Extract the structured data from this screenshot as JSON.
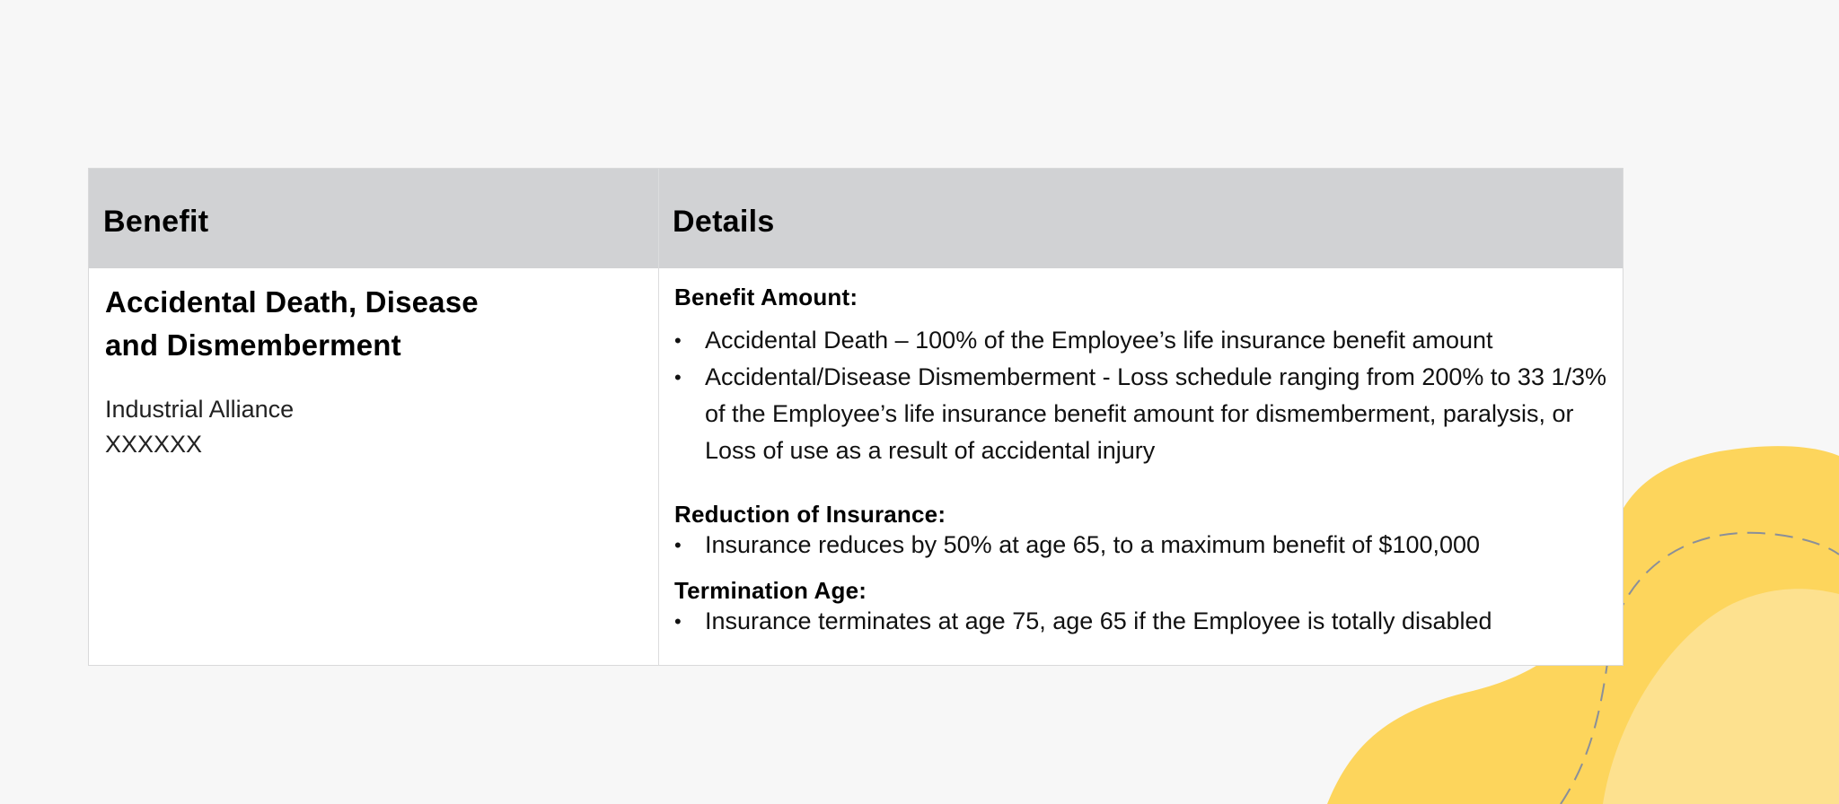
{
  "table": {
    "headers": {
      "benefit": "Benefit",
      "details": "Details"
    },
    "row": {
      "benefit_title": "Accidental Death, Disease\nand Dismemberment",
      "provider": "Industrial Alliance",
      "policy_code": "XXXXXX",
      "sections": [
        {
          "heading": "Benefit Amount:",
          "bullets": [
            "Accidental Death – 100% of the Employee’s life insurance benefit amount",
            "Accidental/Disease Dismemberment - Loss schedule ranging from 200% to 33 1/3% of the Employee’s life insurance benefit amount for dismemberment, paralysis, or Loss of use as a result of accidental injury"
          ]
        },
        {
          "heading": "Reduction of Insurance:",
          "bullets": [
            "Insurance reduces by 50% at age 65, to a maximum benefit of $100,000"
          ]
        },
        {
          "heading": "Termination Age:",
          "bullets": [
            "Insurance terminates at age 75, age 65 if the Employee is totally disabled"
          ]
        }
      ]
    }
  },
  "bullet_glyph": "•",
  "colors": {
    "background": "#f7f7f7",
    "header_fill": "#d1d2d4",
    "blob_dark": "#fdd55c",
    "blob_light": "#fde18f",
    "dash_line": "#8a8f99"
  }
}
